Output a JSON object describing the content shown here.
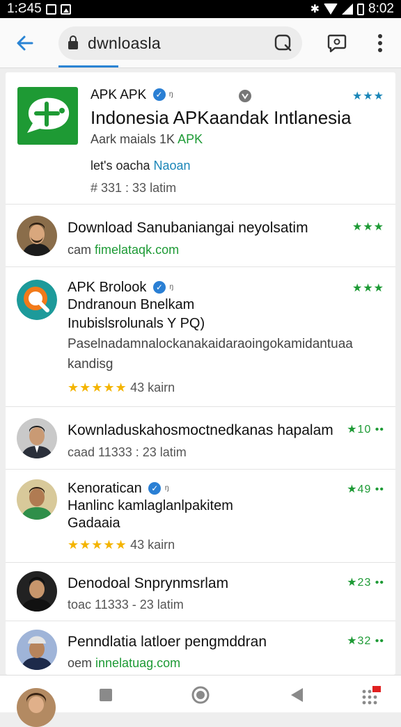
{
  "status_bar": {
    "time": "1:Ƨ45",
    "clock": "8:02"
  },
  "browser": {
    "url": "dwnloasla"
  },
  "results": [
    {
      "app_name": "APK APK",
      "verified_mark": "✓",
      "badge": "ᵑ",
      "rating_stars": "★★★",
      "title": "Indonesia APKaandak Intlanesia",
      "meta_prefix": "Aark maials 1K",
      "meta_link": "APK",
      "desc_prefix": "let's oacha",
      "desc_link": "Naoan",
      "stats": "# 331 : 33 latim",
      "icon": "apk-logo-icon"
    },
    {
      "title": "Download Sanubaniangai neyolsatim",
      "sub_prefix": "cam",
      "sub_link": "fimelataqk.com",
      "rating": "★★★",
      "icon": "avatar-man-beard"
    },
    {
      "app_name": "APK Brolook",
      "verified_mark": "✓",
      "badge": "ᵑ",
      "line2": "Dndranoun Bnelkam",
      "line3": "Inubislsrolunals Y PQ)",
      "desc_line1": "Paselnadamnalockanakaidaraoingokamidantuaa",
      "desc_line2": "kandisg",
      "stars": "★★★★★",
      "stats": "43 kairn",
      "rating": "★★★",
      "icon": "magnifier-logo-icon"
    },
    {
      "title": "Kownladuskahosmoctnedkanas hapalam",
      "sub": "caad 11333 : 23 latim",
      "rating": "★10 ••",
      "icon": "avatar-man-suit"
    },
    {
      "app_name": "Kenoratican",
      "verified_mark": "✓",
      "badge": "ᵑ",
      "line2": "Hanlinc kamlaglanlpakitem",
      "line3": "Gadaaia",
      "stars": "★★★★★",
      "stats": "43 kairn",
      "rating": "★49 ••",
      "icon": "avatar-man-green"
    },
    {
      "title": "Denodoal Snprynmsrlam",
      "sub": "toac 11333 - 23 latim",
      "rating": "★23 ••",
      "icon": "avatar-man-dark"
    },
    {
      "title": "Penndlatia latloer pengmddran",
      "sub_prefix": "oem",
      "sub_link": "innelatuag.com",
      "rating": "★32 ••",
      "icon": "avatar-man-cap"
    }
  ],
  "colors": {
    "accent": "#2a84d4",
    "green": "#1d9a35",
    "star": "#f4b400"
  }
}
